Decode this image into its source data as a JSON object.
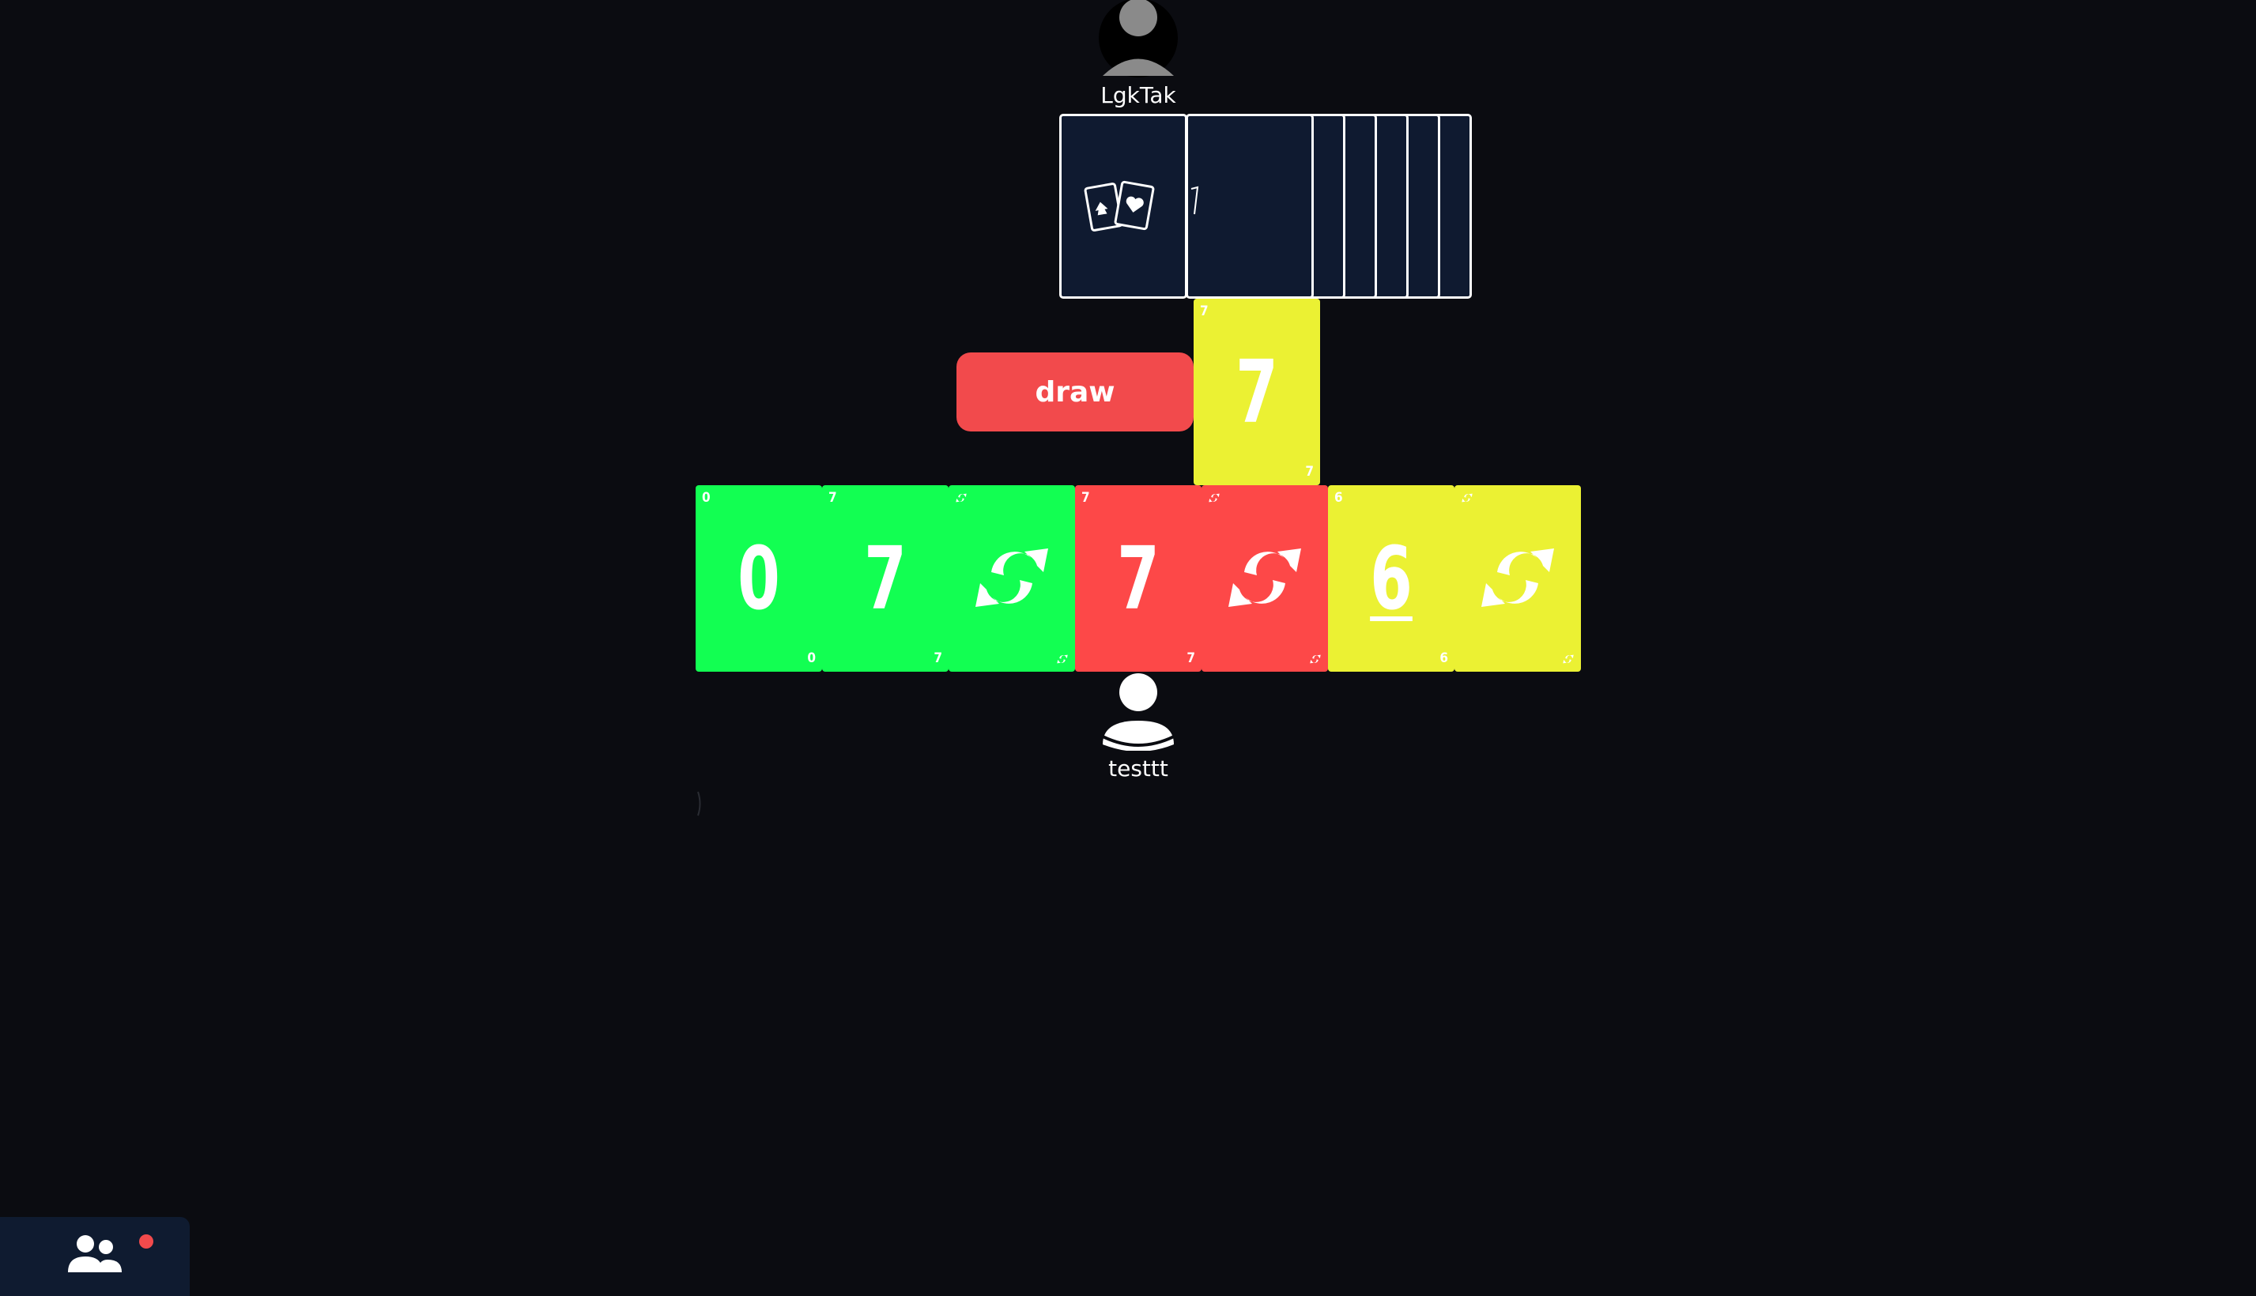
{
  "opponent": {
    "name": "LgkTak",
    "avatar_icon": "user-avatar-icon",
    "avatar_color": "#8a8a8a",
    "card_count": 7,
    "card_back_icon": "card-pair-icon"
  },
  "player": {
    "name": "testtt",
    "avatar_icon": "user-avatar-icon",
    "avatar_color": "#ffffff"
  },
  "draw_button": {
    "label": "draw",
    "color": "#f24a4c"
  },
  "discard_pile": {
    "top_card": {
      "color": "yellow",
      "value": "7"
    }
  },
  "hand": [
    {
      "color": "green",
      "value": "0"
    },
    {
      "color": "green",
      "value": "7"
    },
    {
      "color": "green",
      "value": "reverse"
    },
    {
      "color": "red",
      "value": "7"
    },
    {
      "color": "red",
      "value": "reverse"
    },
    {
      "color": "yellow",
      "value": "6"
    },
    {
      "color": "yellow",
      "value": "reverse"
    }
  ],
  "colors": {
    "green": "#12ff52",
    "red": "#fd4848",
    "yellow": "#ebf133",
    "background": "#0b0c11",
    "card_back": "#0f1a30",
    "panel": "#0f1b30"
  },
  "social_panel": {
    "icon": "users-icon",
    "notification": true
  }
}
